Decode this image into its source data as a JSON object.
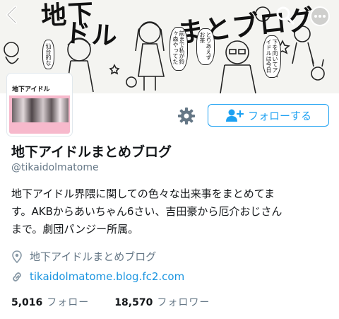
{
  "banner": {
    "title_part1": "地下",
    "title_part2": "ドル",
    "title_part3": "まとブログ",
    "bubble1": "前まで私が鈴ヶ森やってた",
    "bubble2": "とりあえずお茶",
    "bubble3": "仙台的な",
    "bubble4": "下を向いてアイドルは今日"
  },
  "nav": {
    "back_icon": "chevron-left-icon",
    "search_icon": "search-icon",
    "more_icon": "more-icon"
  },
  "avatar": {
    "text": "地下アイドル"
  },
  "actions": {
    "follow_label": "フォローする"
  },
  "profile": {
    "display_name": "地下アイドルまとめブログ",
    "handle": "@tikaidolmatome",
    "bio_lines": [
      "地下アイドル界隈に関しての色々な出来事をまとめてま",
      "す。AKBからあいちゃん6さい、吉田豪から厄介おじさん",
      "まで。劇団パンジー所属。"
    ],
    "location": "地下アイドルまとめブログ",
    "url": "tikaidolmatome.blog.fc2.com"
  },
  "stats": {
    "following_count": "5,016",
    "following_label": "フォロー",
    "followers_count": "18,570",
    "followers_label": "フォロワー"
  },
  "colors": {
    "accent": "#1da1f2",
    "link": "#1b95e0",
    "muted": "#657786",
    "avatar_pink": "#f7b9cc"
  }
}
